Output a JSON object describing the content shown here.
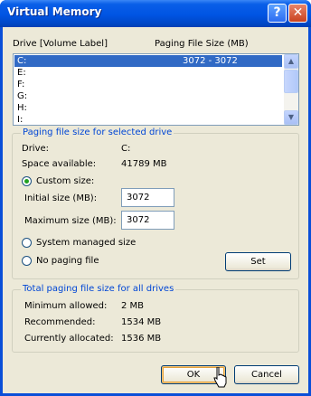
{
  "window": {
    "title": "Virtual Memory",
    "help_glyph": "?",
    "close_glyph": "✕"
  },
  "list": {
    "col_drive": "Drive  [Volume Label]",
    "col_size": "Paging File Size (MB)",
    "rows": [
      {
        "drive": "C:",
        "size": "3072 - 3072"
      },
      {
        "drive": "E:",
        "size": ""
      },
      {
        "drive": "F:",
        "size": ""
      },
      {
        "drive": "G:",
        "size": ""
      },
      {
        "drive": "H:",
        "size": ""
      },
      {
        "drive": "I:",
        "size": ""
      }
    ],
    "selected_row": 0
  },
  "selected_drive_group": {
    "title": "Paging file size for selected drive",
    "drive_label": "Drive:",
    "drive_value": "C:",
    "space_label": "Space available:",
    "space_value": "41789 MB",
    "custom_label": "Custom size:",
    "initial_label": "Initial size (MB):",
    "initial_value": "3072",
    "max_label": "Maximum size (MB):",
    "max_value": "3072",
    "system_label": "System managed size",
    "nopaging_label": "No paging file",
    "selected_option": "custom",
    "set_label": "Set"
  },
  "total_group": {
    "title": "Total paging file size for all drives",
    "min_label": "Minimum allowed:",
    "min_value": "2 MB",
    "rec_label": "Recommended:",
    "rec_value": "1534 MB",
    "cur_label": "Currently allocated:",
    "cur_value": "1536 MB"
  },
  "buttons": {
    "ok": "OK",
    "cancel": "Cancel"
  }
}
